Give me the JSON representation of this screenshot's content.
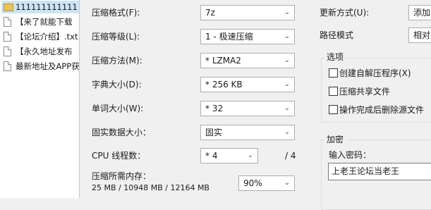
{
  "file_list": {
    "items": [
      {
        "name": "111111111111",
        "type": "folder",
        "selected": true
      },
      {
        "name": "【来了就能下载",
        "type": "file"
      },
      {
        "name": "【论坛介绍】.txt",
        "type": "file"
      },
      {
        "name": "【永久地址发布",
        "type": "file"
      },
      {
        "name": "最新地址及APP获",
        "type": "file"
      }
    ]
  },
  "compression": {
    "format_label": "压缩格式(F):",
    "format_value": "7z",
    "level_label": "压缩等级(L):",
    "level_value": "1 - 极速压缩",
    "method_label": "压缩方法(M):",
    "method_value": "* LZMA2",
    "dict_label": "字典大小(D):",
    "dict_value": "* 256 KB",
    "word_label": "单词大小(W):",
    "word_value": "* 32",
    "solid_label": "固实数据大小：",
    "solid_value": "固实",
    "threads_label": "CPU 线程数：",
    "threads_value": "* 4",
    "threads_total": "/ 4",
    "memory_label": "压缩所需内存：",
    "memory_value": "25 MB / 10948 MB / 12164 MB",
    "memory_percent": "90%"
  },
  "update": {
    "mode_label": "更新方式(U):",
    "mode_value": "添加并",
    "path_label": "路径模式",
    "path_value": "相对路"
  },
  "options": {
    "title": "选项",
    "items": [
      {
        "label": "创建自解压程序(X)",
        "checked": false
      },
      {
        "label": "压缩共享文件",
        "checked": false
      },
      {
        "label": "操作完成后删除源文件",
        "checked": false
      }
    ]
  },
  "encryption": {
    "title": "加密",
    "password_label": "输入密码：",
    "password_value": "上老王论坛当老王"
  }
}
